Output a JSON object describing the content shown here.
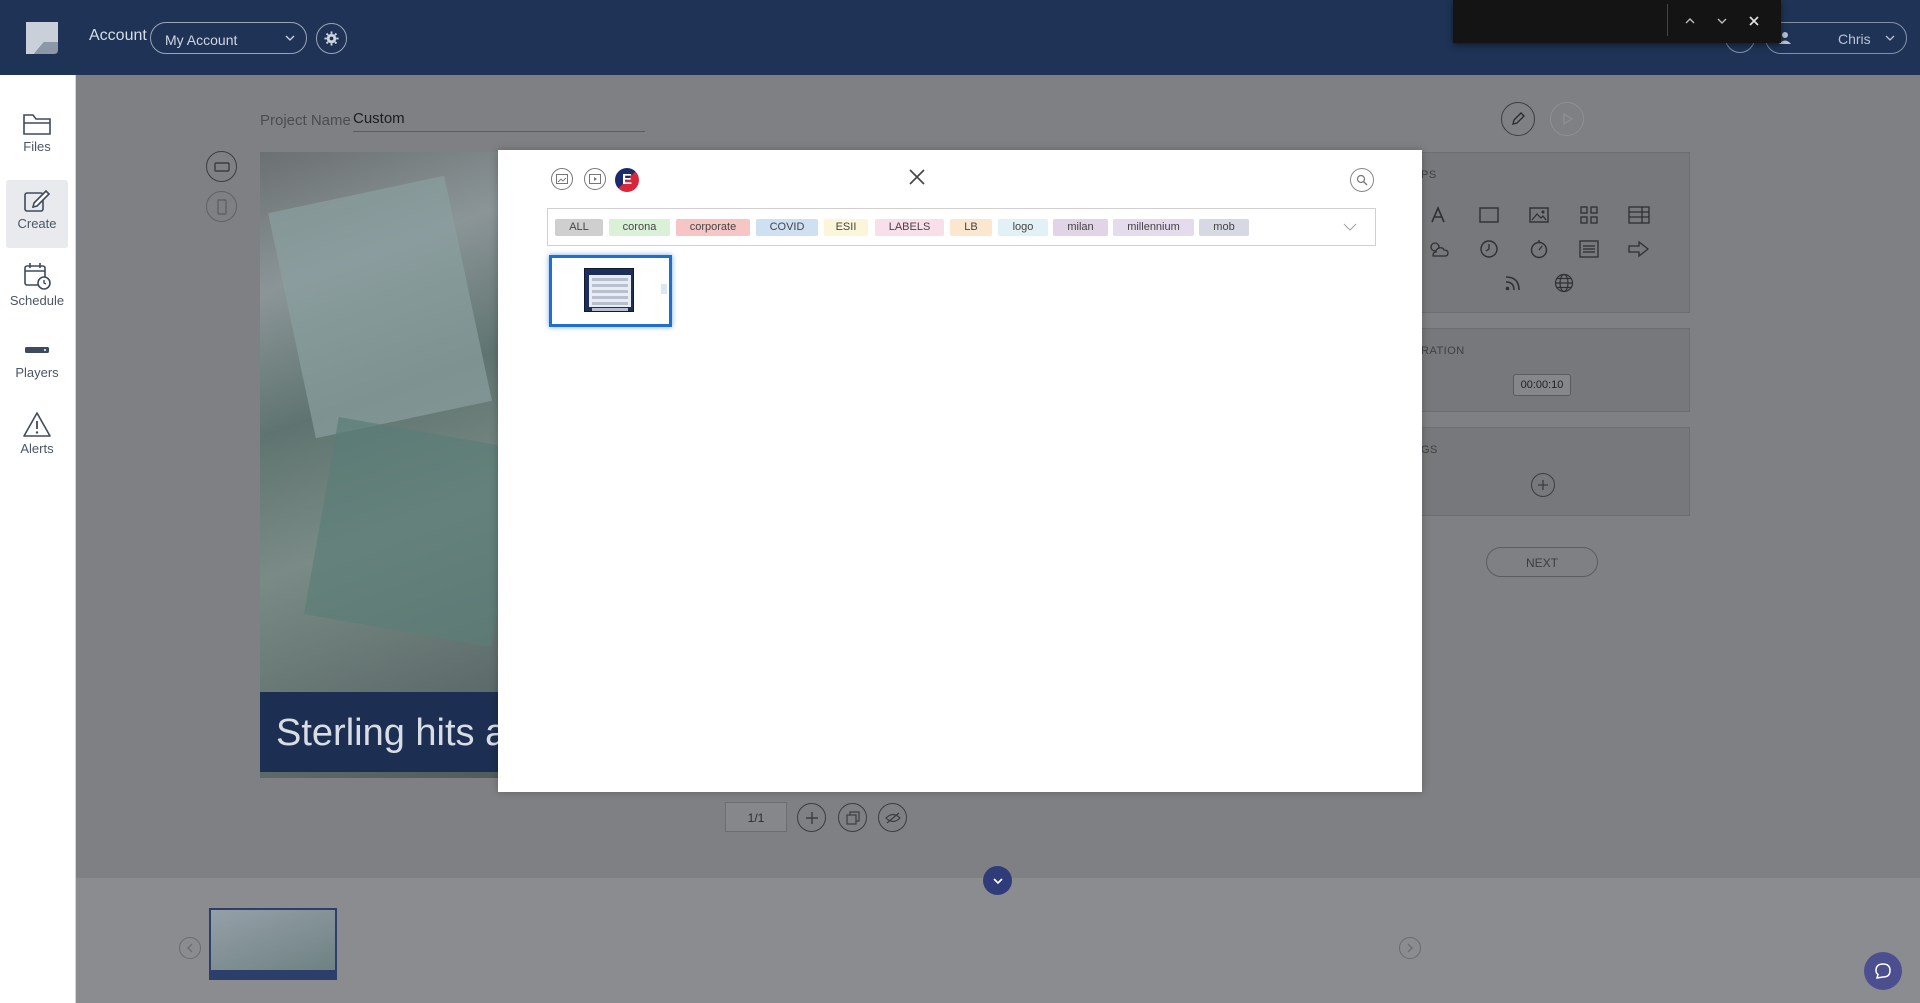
{
  "header": {
    "account_label": "Account",
    "account_select": "My Account",
    "user_name": "Chris"
  },
  "sidebar": {
    "items": [
      {
        "label": "Files",
        "icon": "folder-icon"
      },
      {
        "label": "Create",
        "icon": "edit-icon",
        "active": true
      },
      {
        "label": "Schedule",
        "icon": "calendar-clock-icon"
      },
      {
        "label": "Players",
        "icon": "player-device-icon"
      },
      {
        "label": "Alerts",
        "icon": "warning-icon"
      }
    ]
  },
  "editor": {
    "project_label": "Project Name",
    "project_name": "Custom",
    "headline": "Sterling hits a",
    "panel_apps_label": "PS",
    "panel_duration_label": "RATION",
    "duration": "00:00:10",
    "panel_tags_label": "GS",
    "next_label": "NEXT",
    "page_counter": "1/1"
  },
  "modal": {
    "brand_letter": "E",
    "tags": [
      {
        "label": "ALL",
        "color": "#cfcfcf"
      },
      {
        "label": "corona",
        "color": "#daf0d8"
      },
      {
        "label": "corporate",
        "color": "#f6c6c6"
      },
      {
        "label": "COVID",
        "color": "#cfe0f3"
      },
      {
        "label": "ESII",
        "color": "#fbf6da"
      },
      {
        "label": "LABELS",
        "color": "#f8dfe9"
      },
      {
        "label": "LB",
        "color": "#fbe6cf"
      },
      {
        "label": "logo",
        "color": "#e2f1f6"
      },
      {
        "label": "milan",
        "color": "#e0d4e6"
      },
      {
        "label": "millennium",
        "color": "#e4dcec"
      },
      {
        "label": "mob",
        "color": "#d6d8e3"
      }
    ]
  },
  "colors": {
    "topbar": "#1e3355",
    "overlay": "#7e8083",
    "selection": "#1f6fd0",
    "accent": "#303b7a"
  }
}
